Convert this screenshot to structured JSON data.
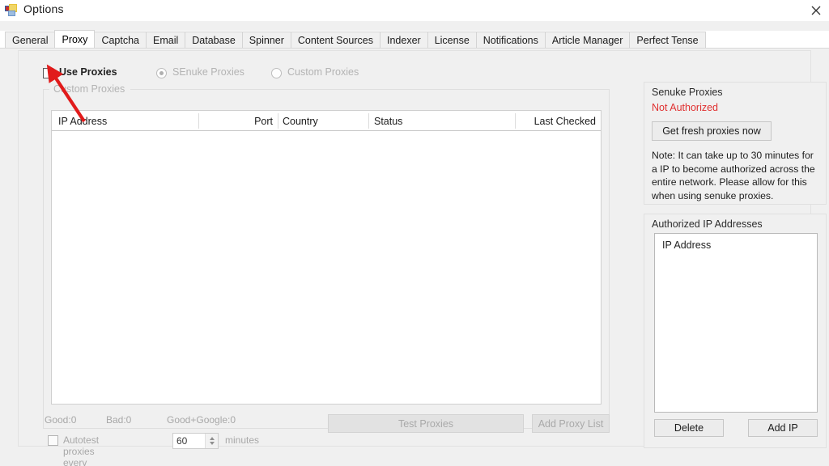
{
  "window": {
    "title": "Options",
    "app_icon": "app-form-icon",
    "close_label": "✕"
  },
  "tabs": [
    {
      "label": "General",
      "active": false
    },
    {
      "label": "Proxy",
      "active": true
    },
    {
      "label": "Captcha",
      "active": false
    },
    {
      "label": "Email",
      "active": false
    },
    {
      "label": "Database",
      "active": false
    },
    {
      "label": "Spinner",
      "active": false
    },
    {
      "label": "Content Sources",
      "active": false
    },
    {
      "label": "Indexer",
      "active": false
    },
    {
      "label": "License",
      "active": false
    },
    {
      "label": "Notifications",
      "active": false
    },
    {
      "label": "Article Manager",
      "active": false
    },
    {
      "label": "Perfect Tense",
      "active": false
    }
  ],
  "proxy": {
    "use_proxies_label": "Use Proxies",
    "use_proxies_checked": false,
    "senuke_proxies_label": "SEnuke Proxies",
    "senuke_proxies_selected": true,
    "custom_proxies_radio_label": "Custom Proxies",
    "custom_proxies_selected": false,
    "groupbox_label": "Custom Proxies",
    "table": {
      "columns": [
        "IP Address",
        "Port",
        "Country",
        "Status",
        "Last Checked"
      ],
      "rows": []
    },
    "stats": {
      "good": "Good:0",
      "bad": "Bad:0",
      "good_google": "Good+Google:0"
    },
    "autotest": {
      "label_before": "Autotest proxies every",
      "value": "60",
      "label_after": "minutes",
      "checked": false
    },
    "buttons": {
      "test_proxies": "Test Proxies",
      "add_proxy_list": "Add Proxy List"
    }
  },
  "senuke_panel": {
    "title": "Senuke Proxies",
    "status": "Not Authorized",
    "status_color": "#e03030",
    "get_fresh_button": "Get fresh proxies now",
    "note": "Note: It can take up to 30 minutes for a IP to become authorized across the entire network. Please allow for this when using senuke proxies."
  },
  "authorized_panel": {
    "title": "Authorized IP Addresses",
    "list_header": "IP Address",
    "items": [],
    "delete_button": "Delete",
    "add_ip_button": "Add IP"
  },
  "annotation": {
    "arrow_color": "#e11b1b",
    "points_at": "use-proxies-checkbox"
  }
}
